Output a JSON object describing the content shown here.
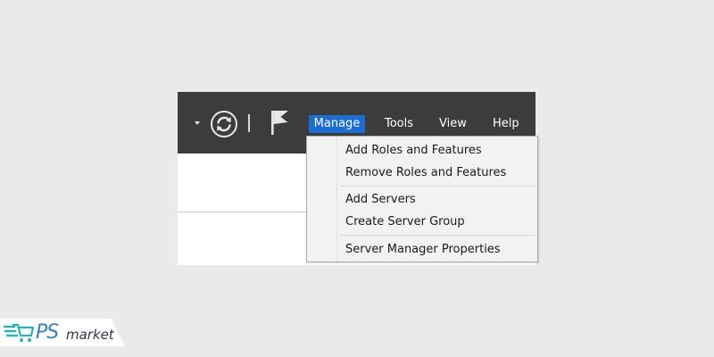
{
  "toolbar": {
    "background_color": "#3c3c3c",
    "icons": {
      "dropdown": "chevron-down-icon",
      "refresh": "refresh-icon",
      "notifications": "flag-icon"
    }
  },
  "menu_bar": {
    "items": [
      {
        "label": "Manage",
        "active": true
      },
      {
        "label": "Tools",
        "active": false
      },
      {
        "label": "View",
        "active": false
      },
      {
        "label": "Help",
        "active": false
      }
    ],
    "active_highlight_color": "#1c6ed2"
  },
  "manage_menu": {
    "groups": [
      {
        "items": [
          {
            "label": "Add Roles and Features"
          },
          {
            "label": "Remove Roles and Features"
          }
        ]
      },
      {
        "items": [
          {
            "label": "Add Servers"
          },
          {
            "label": "Create Server Group"
          }
        ]
      },
      {
        "items": [
          {
            "label": "Server Manager Properties"
          }
        ]
      }
    ]
  },
  "watermark": {
    "brand_prefix": "PS",
    "brand_suffix": "market",
    "accent_color": "#3b7fc4",
    "icon": "cart-icon"
  }
}
